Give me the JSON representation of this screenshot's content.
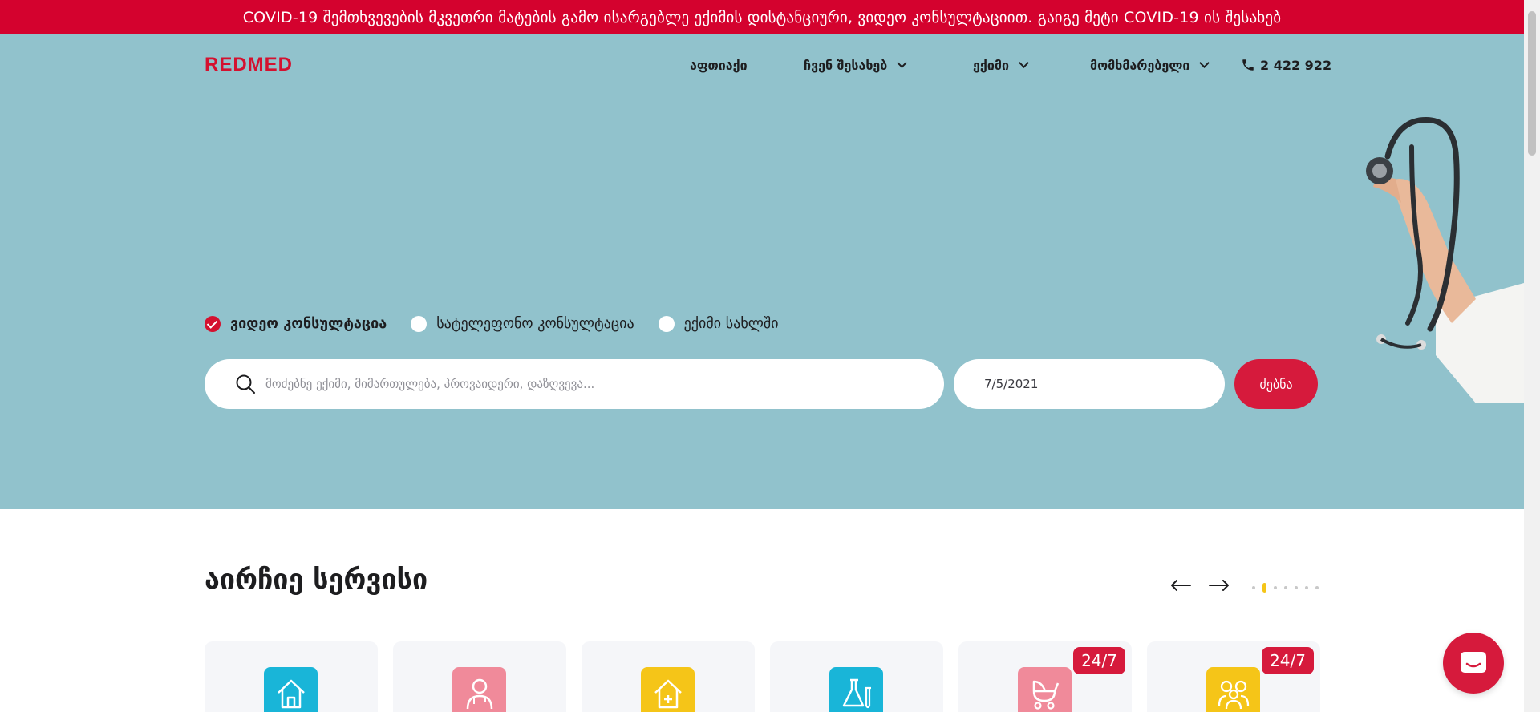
{
  "banner": {
    "text": "COVID-19 შემთხვევების მკვეთრი მატების გამო ისარგებლე ექიმის დისტანციური, ვიდეო კონსულტაციით. გაიგე მეტი COVID-19 ის შესახებ"
  },
  "header": {
    "logo": "REDMED",
    "nav": [
      {
        "label": "აფთიაქი",
        "has_dropdown": false
      },
      {
        "label": "ჩვენ შესახებ",
        "has_dropdown": true
      },
      {
        "label": "ექიმი",
        "has_dropdown": true
      },
      {
        "label": "მომხმარებელი",
        "has_dropdown": true
      }
    ],
    "phone": "2 422 922"
  },
  "search": {
    "options": [
      {
        "label": "ვიდეო კონსულტაცია",
        "checked": true
      },
      {
        "label": "სატელეფონო კონსულტაცია",
        "checked": false
      },
      {
        "label": "ექიმი სახლში",
        "checked": false
      }
    ],
    "placeholder": "მოძებნე ექიმი, მიმართულება, პროვაიდერი, დაზღვევა...",
    "date": "7/5/2021",
    "button": "ძებნა"
  },
  "services": {
    "title": "აირჩიე სერვისი",
    "carousel_pages": 7,
    "active_page": 2,
    "cards": [
      {
        "icon": "home-icon",
        "color": "#19b5d8",
        "badge": ""
      },
      {
        "icon": "doctor-icon",
        "color": "#f08a9a",
        "badge": ""
      },
      {
        "icon": "home-plus-icon",
        "color": "#f5c518",
        "badge": ""
      },
      {
        "icon": "lab-flask-icon",
        "color": "#19b5d8",
        "badge": ""
      },
      {
        "icon": "stroller-icon",
        "color": "#f08a9a",
        "badge": "24/7"
      },
      {
        "icon": "group-icon",
        "color": "#f5c518",
        "badge": "24/7"
      }
    ]
  },
  "colors": {
    "brand": "#d4112f",
    "hero_bg": "#91c2cc",
    "banner": "#d4022e"
  }
}
